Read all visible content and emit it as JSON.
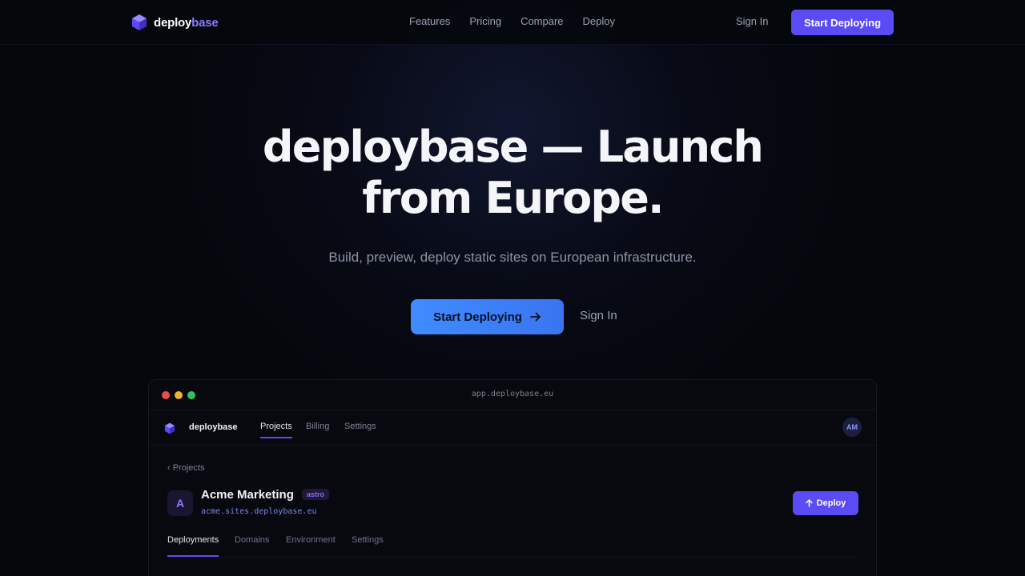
{
  "nav": {
    "brand_prefix": "deploy",
    "brand_suffix": "base",
    "links": [
      "Features",
      "Pricing",
      "Compare",
      "Deploy"
    ],
    "signin": "Sign In",
    "cta": "Start Deploying"
  },
  "hero": {
    "title_line1": "deploybase — Launch",
    "title_line2": "from Europe.",
    "subtitle": "Build, preview, deploy static sites on European infrastructure.",
    "cta": "Start Deploying",
    "signin": "Sign In"
  },
  "app": {
    "url": "app.deploybase.eu",
    "brand": "deploybase",
    "tabs": [
      "Projects",
      "Billing",
      "Settings"
    ],
    "avatar": "AM",
    "breadcrumb": "‹ Projects",
    "project": {
      "initial": "A",
      "name": "Acme Marketing",
      "framework": "astro",
      "domain": "acme.sites.deploybase.eu"
    },
    "deploy_label": "Deploy",
    "subtabs": [
      "Deployments",
      "Domains",
      "Environment",
      "Settings"
    ]
  },
  "colors": {
    "accent": "#5b4bf5",
    "hero_cta": "#3f8cff",
    "background": "#05070d"
  }
}
